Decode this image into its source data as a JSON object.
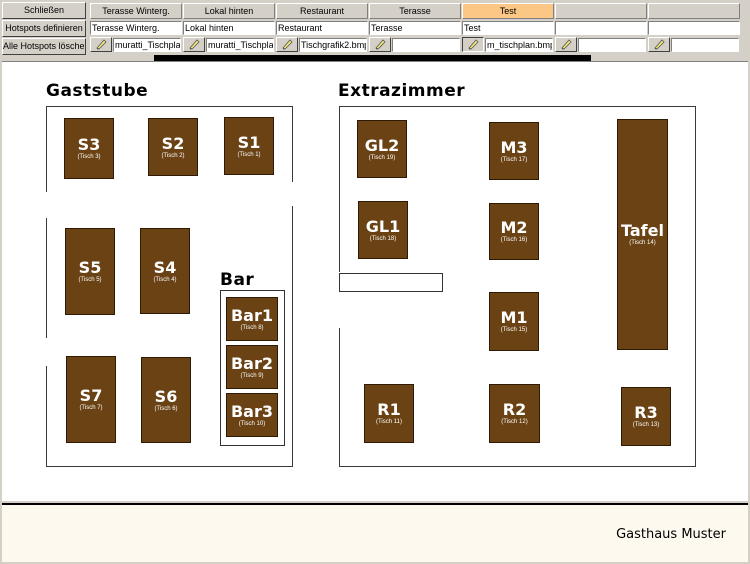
{
  "toolbar": {
    "close_label": "Schließen",
    "define_hotspots_label": "Hotspots definieren",
    "delete_hotspots_label": "Alle Hotspots löschen"
  },
  "columns": [
    {
      "tab": "Terasse Winterg.",
      "name": "Terasse Winterg.",
      "file": "muratti_Tischplan_"
    },
    {
      "tab": "Lokal hinten",
      "name": "Lokal hinten",
      "file": "muratti_Tischplan_"
    },
    {
      "tab": "Restaurant",
      "name": "Restaurant",
      "file": "Tischgrafik2.bmp"
    },
    {
      "tab": "Terasse",
      "name": "Terasse",
      "file": ""
    },
    {
      "tab": "Test",
      "name": "Test",
      "file": "m_tischplan.bmp"
    },
    {
      "tab": "",
      "name": "",
      "file": ""
    },
    {
      "tab": "",
      "name": "",
      "file": ""
    }
  ],
  "colors": {
    "active_tab": "#fcc684",
    "table_fill": "#6a4214"
  },
  "rooms": {
    "gaststube": "Gaststube",
    "extrazimmer": "Extrazimmer",
    "bar": "Bar"
  },
  "tables": {
    "S3": {
      "name": "S3",
      "sub": "(Tisch 3)"
    },
    "S2": {
      "name": "S2",
      "sub": "(Tisch 2)"
    },
    "S1": {
      "name": "S1",
      "sub": "(Tisch 1)"
    },
    "S5": {
      "name": "S5",
      "sub": "(Tisch 5)"
    },
    "S4": {
      "name": "S4",
      "sub": "(Tisch 4)"
    },
    "S7": {
      "name": "S7",
      "sub": "(Tisch 7)"
    },
    "S6": {
      "name": "S6",
      "sub": "(Tisch 6)"
    },
    "Bar1": {
      "name": "Bar1",
      "sub": "(Tisch 8)"
    },
    "Bar2": {
      "name": "Bar2",
      "sub": "(Tisch 9)"
    },
    "Bar3": {
      "name": "Bar3",
      "sub": "(Tisch 10)"
    },
    "GL2": {
      "name": "GL2",
      "sub": "(Tisch 19)"
    },
    "GL1": {
      "name": "GL1",
      "sub": "(Tisch 18)"
    },
    "M3": {
      "name": "M3",
      "sub": "(Tisch 17)"
    },
    "M2": {
      "name": "M2",
      "sub": "(Tisch 16)"
    },
    "M1": {
      "name": "M1",
      "sub": "(Tisch 15)"
    },
    "Tafel": {
      "name": "Tafel",
      "sub": "(Tisch 14)"
    },
    "R1": {
      "name": "R1",
      "sub": "(Tisch 11)"
    },
    "R2": {
      "name": "R2",
      "sub": "(Tisch 12)"
    },
    "R3": {
      "name": "R3",
      "sub": "(Tisch 13)"
    }
  },
  "footer": {
    "restaurant_name": "Gasthaus Muster"
  }
}
